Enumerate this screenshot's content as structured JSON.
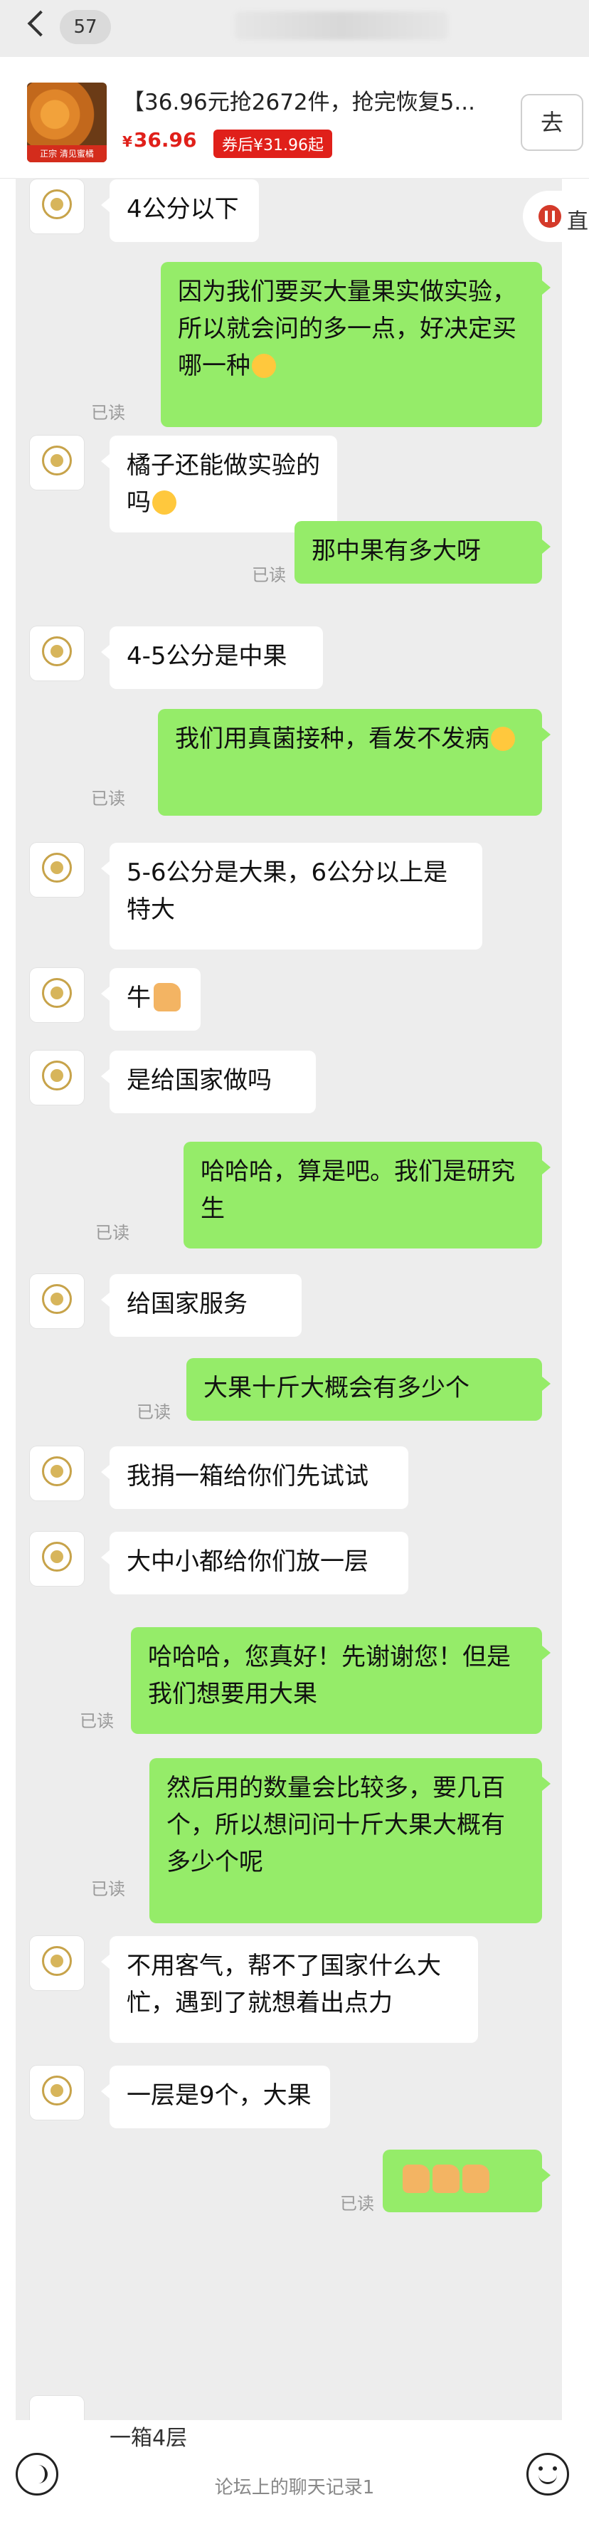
{
  "nav": {
    "back_count": "57"
  },
  "product": {
    "title": "【36.96元抢2672件，抢完恢复5...",
    "price": "36.96",
    "currency": "¥",
    "badge": "券后¥31.96起",
    "go_label": "去",
    "image_tag": "正宗 清见蜜橘"
  },
  "side_button": {
    "label": "直"
  },
  "messages": [
    {
      "dir": "in",
      "text": "4公分以下"
    },
    {
      "dir": "out",
      "text": "因为我们要买大量果实做实验，所以就会问的多一点，好决定买哪一种",
      "emoji": "grin",
      "read": "已读"
    },
    {
      "dir": "in",
      "text": "橘子还能做实验的吗",
      "emoji": "laugh"
    },
    {
      "dir": "out",
      "text": "那中果有多大呀",
      "read": "已读"
    },
    {
      "dir": "in",
      "text": "4-5公分是中果"
    },
    {
      "dir": "out",
      "text": "我们用真菌接种，看发不发病",
      "emoji": "grin",
      "read": "已读"
    },
    {
      "dir": "in",
      "text": "5-6公分是大果，6公分以上是特大"
    },
    {
      "dir": "in",
      "text": "牛",
      "emoji": "thumb"
    },
    {
      "dir": "in",
      "text": "是给国家做吗"
    },
    {
      "dir": "out",
      "text": "哈哈哈，算是吧。我们是研究生",
      "read": "已读"
    },
    {
      "dir": "in",
      "text": "给国家服务"
    },
    {
      "dir": "out",
      "text": "大果十斤大概会有多少个",
      "read": "已读"
    },
    {
      "dir": "in",
      "text": "我捐一箱给你们先试试"
    },
    {
      "dir": "in",
      "text": "大中小都给你们放一层"
    },
    {
      "dir": "out",
      "text": "哈哈哈，您真好！先谢谢您！但是我们想要用大果",
      "read": "已读"
    },
    {
      "dir": "out",
      "text": "然后用的数量会比较多，要几百个，所以想问问十斤大果大概有多少个呢",
      "read": "已读"
    },
    {
      "dir": "in",
      "text": "不用客气，帮不了国家什么大忙，遇到了就想着出点力"
    },
    {
      "dir": "in",
      "text": "一层是9个，大果"
    },
    {
      "dir": "out",
      "text": "",
      "emoji": "thumb3",
      "read": "已读"
    }
  ],
  "bottom": {
    "partial_text": "一箱4层",
    "caption": "论坛上的聊天记录1"
  },
  "icons": {
    "back": "chevron-left-icon",
    "voice": "voice-icon",
    "emoji": "smile-icon"
  },
  "colors": {
    "outgoing_bubble": "#95ec69",
    "incoming_bubble": "#ffffff",
    "chat_background": "#ededed",
    "price": "#e0201a"
  }
}
